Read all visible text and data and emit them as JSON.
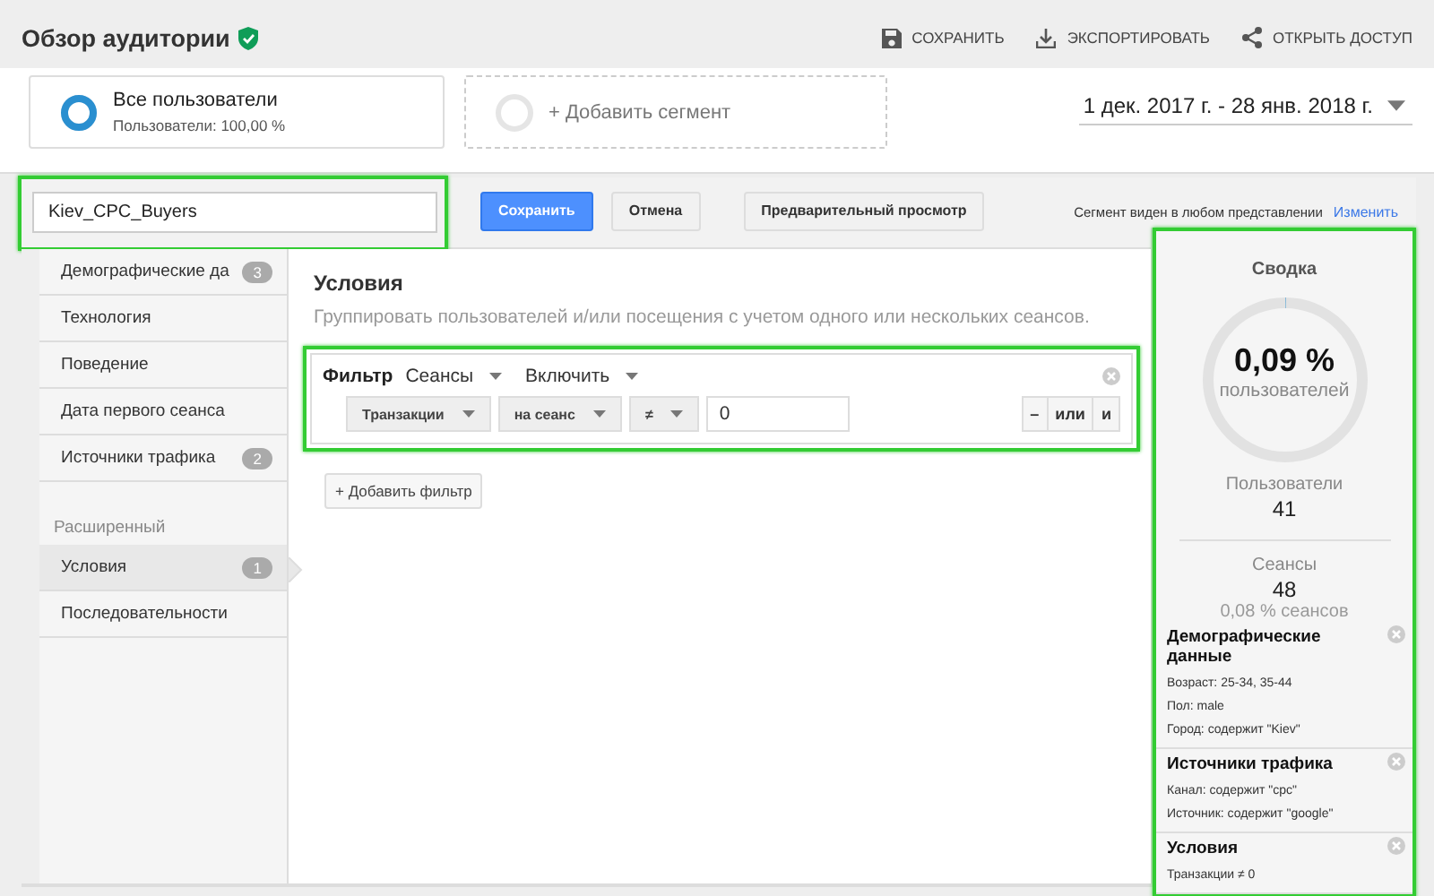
{
  "header": {
    "title": "Обзор аудитории",
    "verified": true,
    "actions": [
      {
        "label": "СОХРАНИТЬ"
      },
      {
        "label": "ЭКСПОРТИРОВАТЬ"
      },
      {
        "label": "ОТКРЫТЬ ДОСТУП"
      }
    ]
  },
  "segments": [
    {
      "kind": "segment",
      "name": "Все пользователи",
      "detail": "Пользователи: 100,00 %",
      "level": 1
    },
    {
      "kind": "add",
      "label": "+ Добавить сегмент"
    }
  ],
  "date_range": "1 дек. 2017 г. - 28 янв. 2018 г.",
  "editor": {
    "name_field": {
      "value": "Kiev_CPC_Buyers",
      "highlighted": true
    },
    "buttons": [
      {
        "kind": "primary",
        "label": "Сохранить"
      },
      {
        "kind": "default",
        "label": "Отмена"
      },
      {
        "kind": "default",
        "label": "Предварительный просмотр"
      }
    ],
    "visibility_note": "Сегмент виден в любом представлении",
    "visibility_link": "Изменить"
  },
  "sidebar": {
    "items": [
      {
        "label": "Демографические да",
        "count": "3",
        "selected": false
      },
      {
        "label": "Технология",
        "selected": false
      },
      {
        "label": "Поведение",
        "selected": false
      },
      {
        "label": "Дата первого сеанса",
        "selected": false
      },
      {
        "label": "Источники трафика",
        "count": "2",
        "selected": false
      }
    ],
    "section": "Расширенный",
    "advanced_items": [
      {
        "label": "Условия",
        "count": "1",
        "selected": true
      },
      {
        "label": "Последовательности",
        "selected": false
      }
    ]
  },
  "conditions": {
    "title": "Условия",
    "description": "Группировать пользователей и/или посещения с учетом одного или нескольких сеансов.",
    "filter": {
      "highlighted": true,
      "label": "Фильтр",
      "scope": "Сеансы",
      "mode": "Включить",
      "metric": "Транзакции",
      "per": "на сеанс",
      "operator": "≠",
      "value": "0",
      "logic_buttons": [
        "–",
        "или",
        "и"
      ]
    },
    "add_filter": "+ Добавить фильтр"
  },
  "summary": {
    "highlighted": true,
    "title": "Сводка",
    "level": 0.0009,
    "percent": "0,09 %",
    "percent_label": "пользователей",
    "users_label": "Пользователи",
    "users": "41",
    "sessions_label": "Сеансы",
    "sessions": "48",
    "sessions_share": "0,08 % сеансов",
    "groups": [
      {
        "title": "Демографические данные",
        "lines": [
          "Возраст: 25-34, 35-44",
          "Пол: male",
          "Город: содержит \"Kiev\""
        ]
      },
      {
        "title": "Источники трафика",
        "lines": [
          "Канал: содержит \"cpc\"",
          "Источник: содержит \"google\""
        ]
      },
      {
        "title": "Условия",
        "lines": [
          "Транзакции ≠ 0"
        ]
      }
    ]
  }
}
